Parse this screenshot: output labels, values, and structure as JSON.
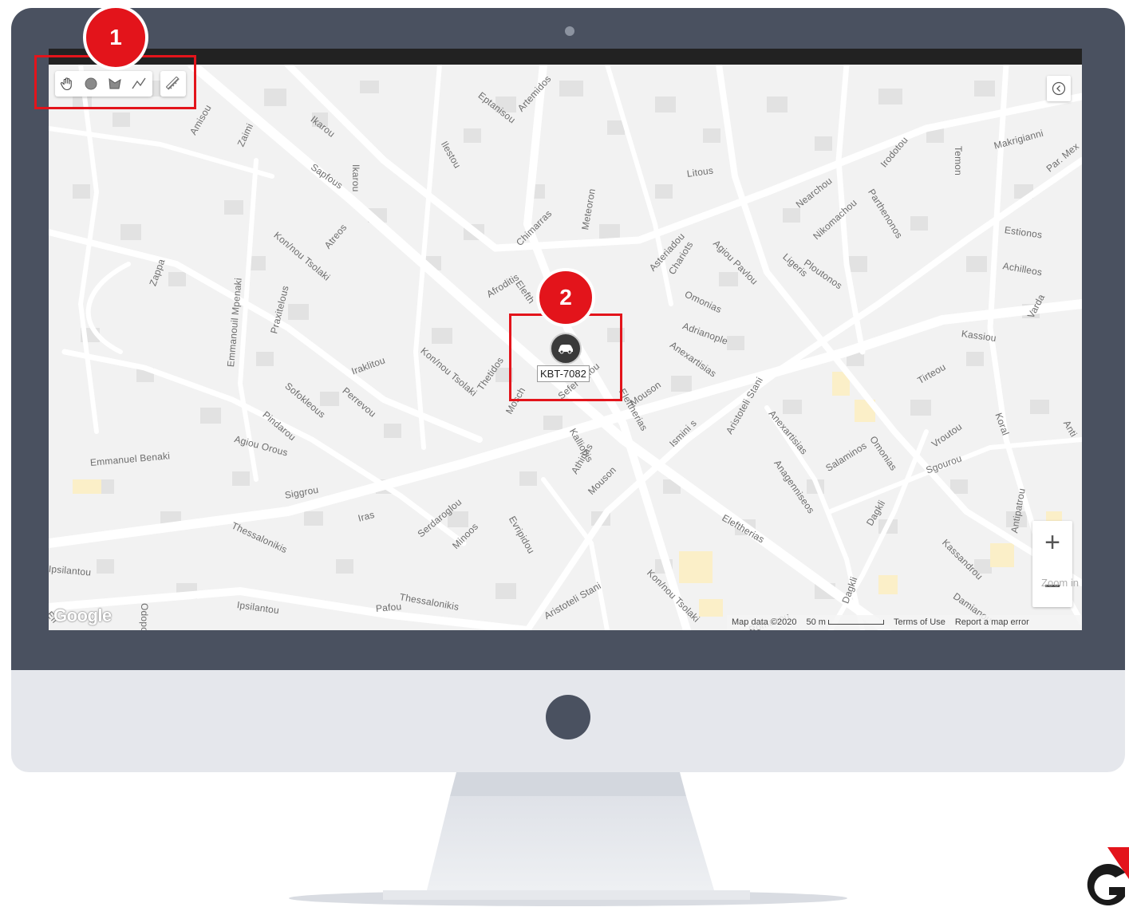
{
  "annotations": [
    {
      "number": "1",
      "color": "#e3141b"
    },
    {
      "number": "2",
      "color": "#e3141b"
    }
  ],
  "toolbar": {
    "tools": [
      {
        "icon": "hand-pan-icon"
      },
      {
        "icon": "circle-icon"
      },
      {
        "icon": "polygon-icon"
      },
      {
        "icon": "polyline-icon"
      }
    ],
    "measure_icon": "ruler-icon"
  },
  "vehicle": {
    "plate": "KBT-7082",
    "icon": "car-icon"
  },
  "map": {
    "zoom_in_label": "+",
    "zoom_tooltip": "Zoom in",
    "google_logo": "Google",
    "map_data": "Map data ©2020",
    "scale": "50 m",
    "terms": "Terms of Use",
    "report": "Report a map error",
    "streets": [
      "Eptanisou",
      "Artemidos",
      "Ikarou",
      "Sapfous",
      "Ikarou",
      "Zaimi",
      "Amisou",
      "Ilestou",
      "Litous",
      "Meteoron",
      "Chimarras",
      "Nearchou",
      "Irodotou",
      "Makrigianni",
      "Par. Mex",
      "Parthenonos",
      "Nikomachou",
      "Ploutonos",
      "Ligeris",
      "Agiou Pavlou",
      "Chariots",
      "Asteriadou",
      "Afroditis",
      "Elefth",
      "Kon/nou Tsolaki",
      "Atreos",
      "Praxitelous",
      "Emmanouil Mpenaki",
      "Zappa",
      "Omonias",
      "Adrianople",
      "Anexartisias",
      "Estionos",
      "Achilleos",
      "Varda",
      "Kassiou",
      "Tirteou",
      "Iraklitou",
      "Kon/nou Tsolaki",
      "Thetidos",
      "Mosch",
      "Sefer oglou",
      "Eleftherias",
      "Mouson",
      "Aristoteli Stani",
      "Anexartisias",
      "Sofokleous",
      "Perrevou",
      "Pindarou",
      "Agiou Orous",
      "Emmanuel Benaki",
      "Siggrou",
      "Ismini s",
      "Kalliopis",
      "Athinas",
      "Mouson",
      "Salaminos",
      "Anagenniseos",
      "Omonias",
      "Vroutou",
      "Sgourou",
      "Koral",
      "Anti",
      "Antipatrou",
      "Dagkli",
      "Kassandrou",
      "Iras",
      "Serdaroglou",
      "Minoos",
      "Evripidou",
      "Eleftherias",
      "Thessalonikis",
      "Ipsilantou",
      "Thessalonikis",
      "Pafou",
      "Ipsilantou",
      "Aristoteli Stani",
      "Kon/nou Tsolaki",
      "Romanou",
      "Damianou",
      "Dagkli",
      "Nikiforou Ou",
      "Temon",
      "Odopoleos",
      "Efi"
    ]
  }
}
